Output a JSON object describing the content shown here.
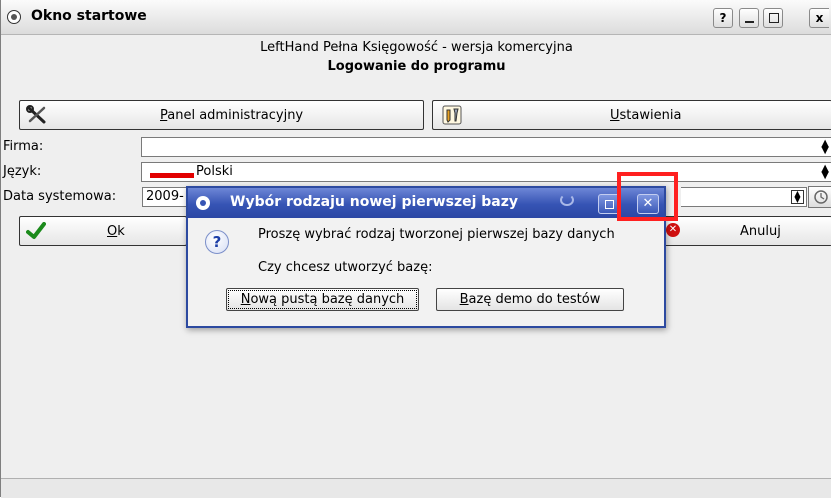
{
  "window": {
    "title": "Okno startowe",
    "controls": {
      "help": "?",
      "close": "x"
    }
  },
  "header": {
    "app_name": "LeftHand Pełna Księgowość - wersja komercyjna",
    "login_title": "Logowanie do programu"
  },
  "buttons": {
    "admin_panel": {
      "hotkey": "P",
      "rest": "anel administracyjny"
    },
    "settings": {
      "hotkey": "U",
      "rest": "stawienia"
    },
    "ok": {
      "hotkey": "O",
      "rest": "k"
    },
    "cancel": "Anuluj"
  },
  "form": {
    "firma_label": "Firma:",
    "firma_value": "",
    "jezyk_label": "Język:",
    "jezyk_value": "Polski",
    "data_label": "Data systemowa:",
    "data_value": "2009-"
  },
  "dialog": {
    "title": "Wybór rodzaju nowej pierwszej bazy",
    "close": "✕",
    "icon_glyph": "?",
    "message": "Proszę wybrać rodzaj tworzonej pierwszej bazy danych",
    "question": "Czy chcesz utworzyć bazę:",
    "new_empty": {
      "hotkey": "N",
      "rest": "ową pustą bazę danych"
    },
    "demo": {
      "hotkey": "B",
      "rest": "azę demo do testów"
    }
  },
  "colors": {
    "dialog_title_bar": "#3654b4",
    "highlight": "#ff2020",
    "flag_red": "#e20000"
  }
}
